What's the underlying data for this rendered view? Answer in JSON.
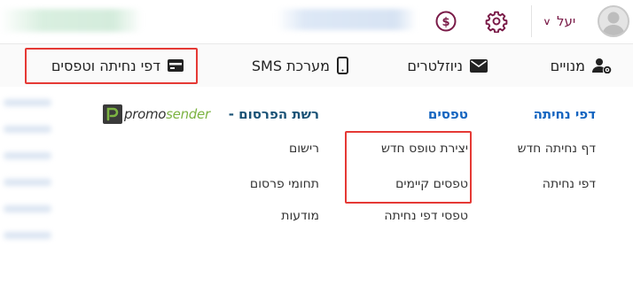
{
  "topbar": {
    "user_name": "יעל",
    "icons": {
      "dollar": "dollar-circle-icon",
      "settings": "gear-icon",
      "chevron": "chevron-down-icon",
      "avatar": "user-avatar-icon"
    }
  },
  "nav": {
    "items": [
      {
        "label": "מנויים",
        "icon": "users-gear-icon"
      },
      {
        "label": "ניוזלטרים",
        "icon": "envelope-icon"
      },
      {
        "label": "מערכת SMS",
        "icon": "mobile-phone-icon"
      },
      {
        "label": "דפי נחיתה וטפסים",
        "icon": "credit-card-icon"
      }
    ]
  },
  "menu": {
    "landing_pages": {
      "title": "דפי נחיתה",
      "links": [
        "דף נחיתה חדש",
        "דפי נחיתה"
      ]
    },
    "forms": {
      "title": "טפסים",
      "links": [
        "יצירת טופס חדש",
        "טפסים קיימים",
        "טפסי דפי נחיתה"
      ]
    },
    "ad_network": {
      "title": "רשת הפרסום -",
      "logo_text_a": "promo",
      "logo_text_b": "sender",
      "links": [
        "רישום",
        "תחומי פרסום",
        "מודעות"
      ]
    }
  },
  "colors": {
    "accent": "#7a1b48",
    "link_blue": "#1565c0",
    "highlight_red": "#e53935",
    "promo_green": "#7cb342"
  }
}
